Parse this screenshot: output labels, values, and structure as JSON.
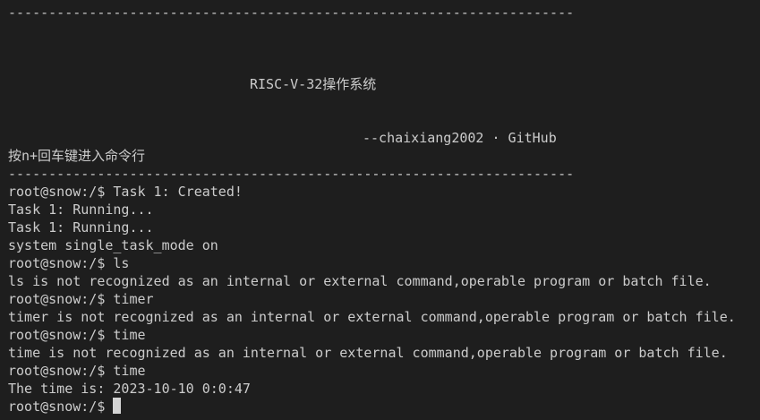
{
  "terminal": {
    "separator_top": "----------------------------------------------------------------------",
    "os_title": "RISC-V-32操作系统",
    "author_credit": "--chaixiang2002 · GitHub",
    "enter_hint": "按n+回车键进入命令行",
    "separator_bottom": "----------------------------------------------------------------------",
    "lines": [
      "root@snow:/$ Task 1: Created!",
      "Task 1: Running...",
      "Task 1: Running...",
      "system single_task_mode on",
      "root@snow:/$ ls",
      "ls is not recognized as an internal or external command,operable program or batch file.",
      "root@snow:/$ timer",
      "timer is not recognized as an internal or external command,operable program or batch file.",
      "root@snow:/$ time",
      "time is not recognized as an internal or external command,operable program or batch file.",
      "root@snow:/$ time",
      "The time is: 2023-10-10 0:0:47"
    ],
    "prompt": "root@snow:/$ "
  }
}
